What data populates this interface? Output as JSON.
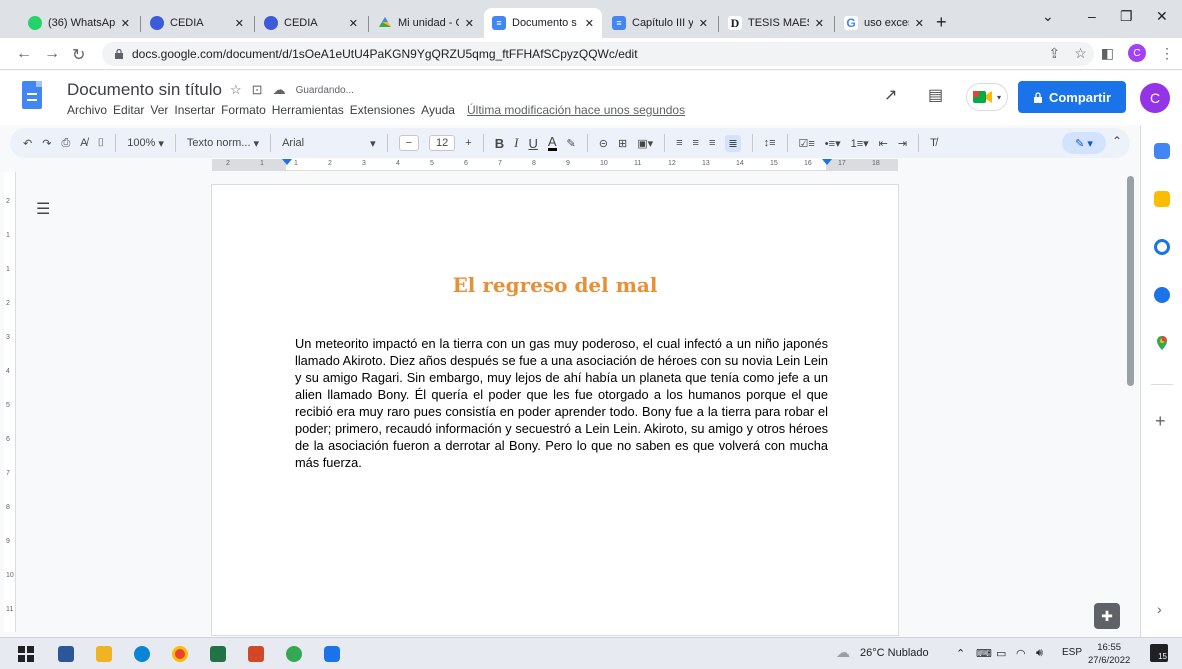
{
  "browser": {
    "tabs": [
      {
        "title": "(36) WhatsAp",
        "favicon": "whatsapp-icon",
        "color": "#25d366",
        "badge": "36"
      },
      {
        "title": "CEDIA",
        "favicon": "cedia-icon",
        "color": "#3b5bdb"
      },
      {
        "title": "CEDIA",
        "favicon": "cedia-icon",
        "color": "#3b5bdb"
      },
      {
        "title": "Mi unidad - G",
        "favicon": "drive-icon",
        "color": "#fbbc04"
      },
      {
        "title": "Documento s",
        "favicon": "docs-icon",
        "color": "#4285f4"
      },
      {
        "title": "Capítulo III y",
        "favicon": "docs-icon",
        "color": "#4285f4"
      },
      {
        "title": "TESIS MAEST",
        "favicon": "tesis-icon",
        "color": "#202124"
      },
      {
        "title": "uso excesivo",
        "favicon": "google-icon",
        "color": "#4285f4"
      }
    ],
    "new_tab_label": "+",
    "url": "docs.google.com/document/d/1sOeA1eUtU4PaKGN9YgQRZU5qmg_ftFFHAfSCpyzQQWc/edit",
    "profile_initial": "C"
  },
  "docs": {
    "title": "Documento sin título",
    "saving_status": "Guardando...",
    "menu": [
      "Archivo",
      "Editar",
      "Ver",
      "Insertar",
      "Formato",
      "Herramientas",
      "Extensiones",
      "Ayuda"
    ],
    "last_modified": "Última modificación hace unos segundos",
    "share_label": "Compartir",
    "avatar_initial": "C",
    "accent_color": "#1a73e8"
  },
  "toolbar": {
    "zoom": "100%",
    "style": "Texto norm...",
    "font": "Arial",
    "font_size": "12",
    "minus": "−",
    "plus": "+",
    "bold": "B",
    "italic": "I",
    "underline": "U",
    "text_color": "A"
  },
  "ruler": {
    "marks": [
      "2",
      "1",
      "1",
      "2",
      "3",
      "4",
      "5",
      "6",
      "7",
      "8",
      "9",
      "10",
      "11",
      "12",
      "13",
      "14",
      "15",
      "16",
      "17",
      "18"
    ],
    "vertical_marks": [
      "2",
      "1",
      "1",
      "2",
      "3",
      "4",
      "5",
      "6",
      "7",
      "8",
      "9",
      "10",
      "11"
    ]
  },
  "document": {
    "heading": "El regreso del mal",
    "heading_color": "#e69138",
    "body": "Un meteorito impactó en la tierra con un gas muy poderoso, el cual infectó a un niño japonés llamado Akiroto. Diez años después se fue a una asociación de héroes con su novia Lein Lein y su amigo Ragari. Sin embargo, muy lejos de ahí había un planeta que tenía como jefe a un alien llamado Bony. Él quería el poder que les fue otorgado a los humanos porque el que recibió era muy raro pues consistía en poder aprender todo. Bony fue a la tierra para robar el poder; primero, recaudó información y secuestró a Lein Lein. Akiroto, su amigo y otros héroes de la asociación fueron a derrotar al Bony. Pero lo que no saben es que volverá con mucha más fuerza."
  },
  "taskbar": {
    "weather": "26°C  Nublado",
    "language": "ESP",
    "time": "16:55",
    "date": "27/6/2022",
    "notifications": "15"
  }
}
